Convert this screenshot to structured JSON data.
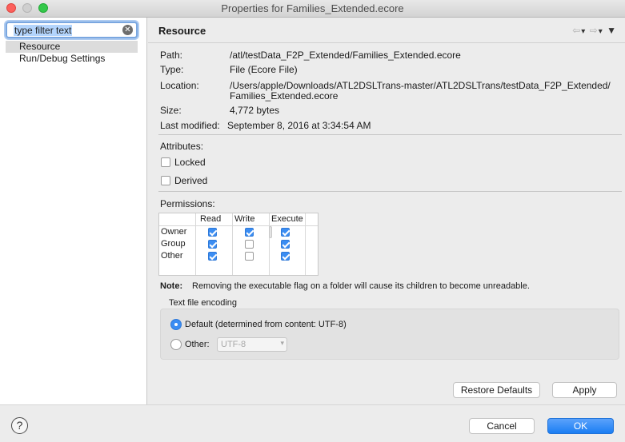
{
  "window": {
    "title": "Properties for Families_Extended.ecore"
  },
  "left_pane": {
    "filter": {
      "placeholder": "type filter text",
      "value": "type filter text"
    },
    "items": [
      {
        "label": "Resource",
        "selected": true
      },
      {
        "label": "Run/Debug Settings",
        "selected": false
      }
    ]
  },
  "page": {
    "header": "Resource",
    "fields": {
      "path_label": "Path:",
      "path_value": "/atl/testData_F2P_Extended/Families_Extended.ecore",
      "type_label": "Type:",
      "type_value": "File  (Ecore File)",
      "location_label": "Location:",
      "location_value_line1": "/Users/apple/Downloads/ATL2DSLTrans-master/ATL2DSLTrans/testData_F2P_Extended/",
      "location_value_line2": "Families_Extended.ecore",
      "size_label": "Size:",
      "size_value": "4,772  bytes",
      "modified_label": "Last modified:",
      "modified_value": "September 8, 2016 at 3:34:54 AM"
    },
    "attributes": {
      "title": "Attributes:",
      "locked": {
        "label": "Locked",
        "checked": false
      },
      "derived": {
        "label": "Derived",
        "checked": false
      }
    },
    "permissions": {
      "title": "Permissions:",
      "columns": [
        "Read",
        "Write",
        "Execute"
      ],
      "rows": [
        {
          "name": "Owner",
          "read": true,
          "write": true,
          "execute": true
        },
        {
          "name": "Group",
          "read": true,
          "write": false,
          "execute": true
        },
        {
          "name": "Other",
          "read": true,
          "write": false,
          "execute": true
        }
      ]
    },
    "note": {
      "label": "Note:",
      "text": "Removing the executable flag on a folder will cause its children to become unreadable."
    },
    "encoding": {
      "title": "Text file encoding",
      "default_option": "Default (determined from content: UTF-8)",
      "other_option": "Other:",
      "other_value": "UTF-8",
      "selected": "default"
    },
    "restore_defaults_label": "Restore Defaults",
    "apply_label": "Apply"
  },
  "footer": {
    "help_icon": "?",
    "cancel_label": "Cancel",
    "ok_label": "OK"
  },
  "colors": {
    "accent": "#1a7ef3",
    "filter_highlight": "#b3d4fc"
  }
}
